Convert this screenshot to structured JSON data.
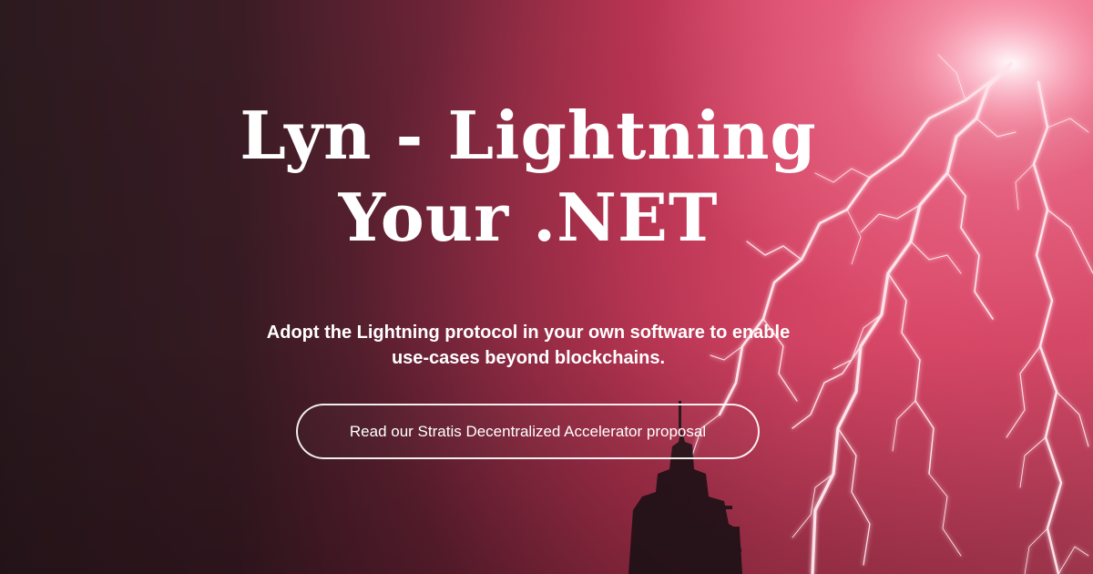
{
  "hero": {
    "title_line1": "Lyn - Lightning",
    "title_line2": "Your .NET",
    "subtitle_line1": "Adopt the Lightning protocol in your own software to enable",
    "subtitle_line2": "use-cases beyond blockchains.",
    "cta_label": "Read our Stratis Decentralized Accelerator proposal"
  },
  "colors": {
    "text": "#ffffff",
    "dark_background": "#2b1a1f",
    "accent_pink": "#e84e6f",
    "lightning_glow": "#ffd6e0"
  },
  "icons": [
    "lightning-background-image"
  ]
}
